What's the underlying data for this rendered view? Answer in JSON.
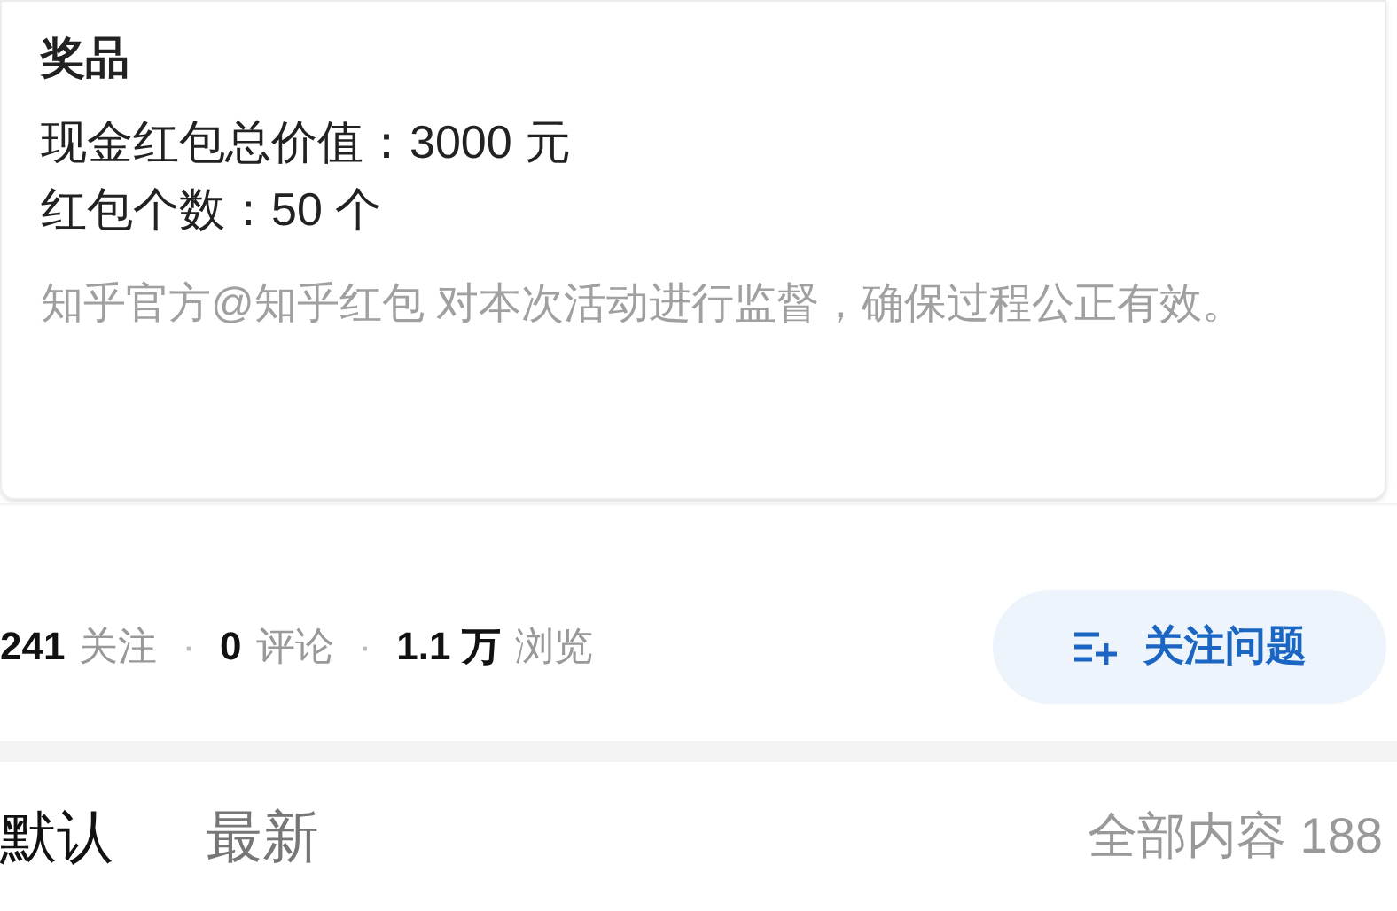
{
  "prize_card": {
    "title": "奖品",
    "lines": [
      "现金红包总价值：3000 元",
      "红包个数：50 个"
    ],
    "note": "知乎官方@知乎红包 对本次活动进行监督，确保过程公正有效。"
  },
  "stats": [
    {
      "kind": "stat",
      "number": "241",
      "label": "关注"
    },
    {
      "kind": "separator",
      "text": "·"
    },
    {
      "kind": "stat",
      "number": "0",
      "label": "评论"
    },
    {
      "kind": "separator",
      "text": "·"
    },
    {
      "kind": "stat",
      "number": "1.1 万",
      "label": "浏览"
    }
  ],
  "follow_button": {
    "label": "关注问题"
  },
  "tabs": [
    {
      "label": "默认",
      "selected": true
    },
    {
      "label": "最新",
      "selected": false
    }
  ],
  "content_count": "全部内容 188"
}
